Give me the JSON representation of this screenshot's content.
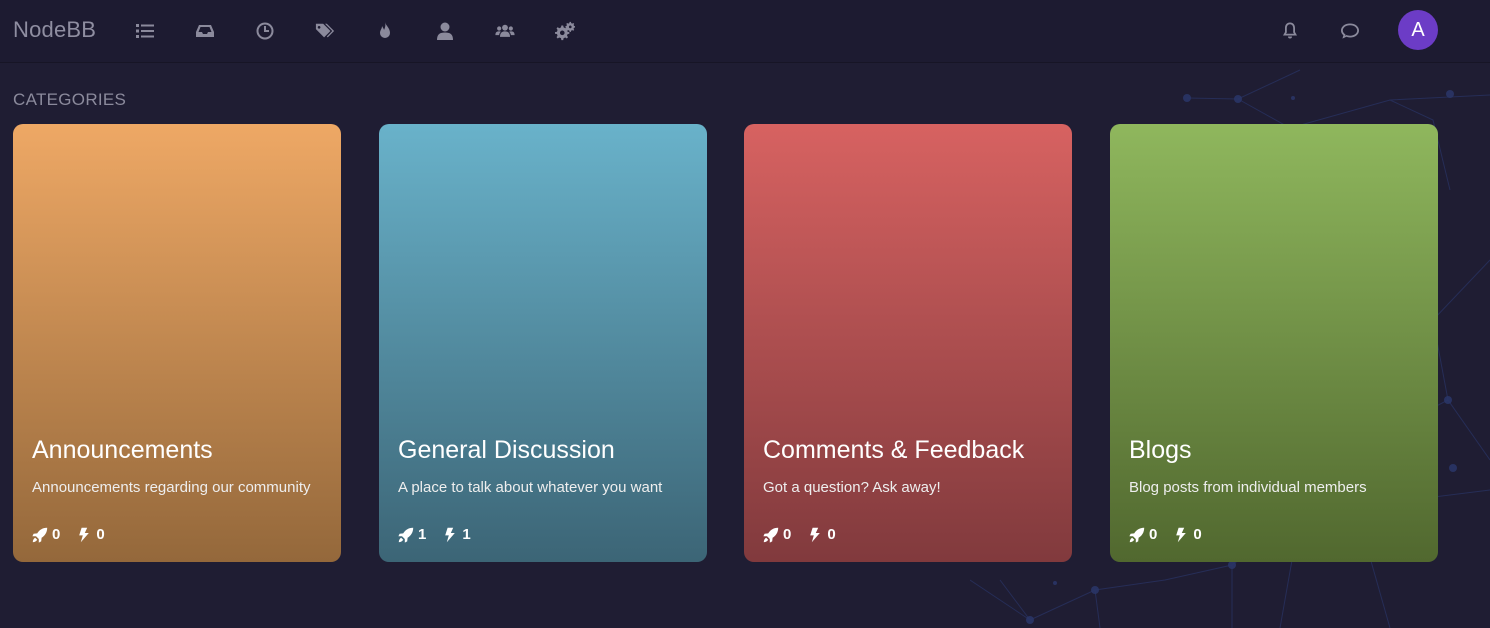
{
  "header": {
    "brand": "NodeBB",
    "avatar_letter": "A",
    "nav_icons": [
      "list-icon",
      "inbox-icon",
      "clock-icon",
      "tags-icon",
      "fire-icon",
      "user-icon",
      "users-icon",
      "cogs-icon"
    ],
    "right_icons": [
      "bell-icon",
      "chat-icon"
    ]
  },
  "section": {
    "title": "CATEGORIES"
  },
  "categories": [
    {
      "title": "Announcements",
      "description": "Announcements regarding our community",
      "topics": "0",
      "posts": "0",
      "color_top": "#eea865",
      "color_bottom": "#94683b"
    },
    {
      "title": "General Discussion",
      "description": "A place to talk about whatever you want",
      "topics": "1",
      "posts": "1",
      "color_top": "#69b2ca",
      "color_bottom": "#3c6576"
    },
    {
      "title": "Comments & Feedback",
      "description": "Got a question? Ask away!",
      "topics": "0",
      "posts": "0",
      "color_top": "#d76261",
      "color_bottom": "#813a3d"
    },
    {
      "title": "Blogs",
      "description": "Blog posts from individual members",
      "topics": "0",
      "posts": "0",
      "color_top": "#8fb75d",
      "color_bottom": "#51682f"
    }
  ],
  "colors": {
    "background": "#1f1d33",
    "header": "#1d1b31",
    "avatar": "#6c3cc6",
    "muted": "#8b8a9c"
  }
}
